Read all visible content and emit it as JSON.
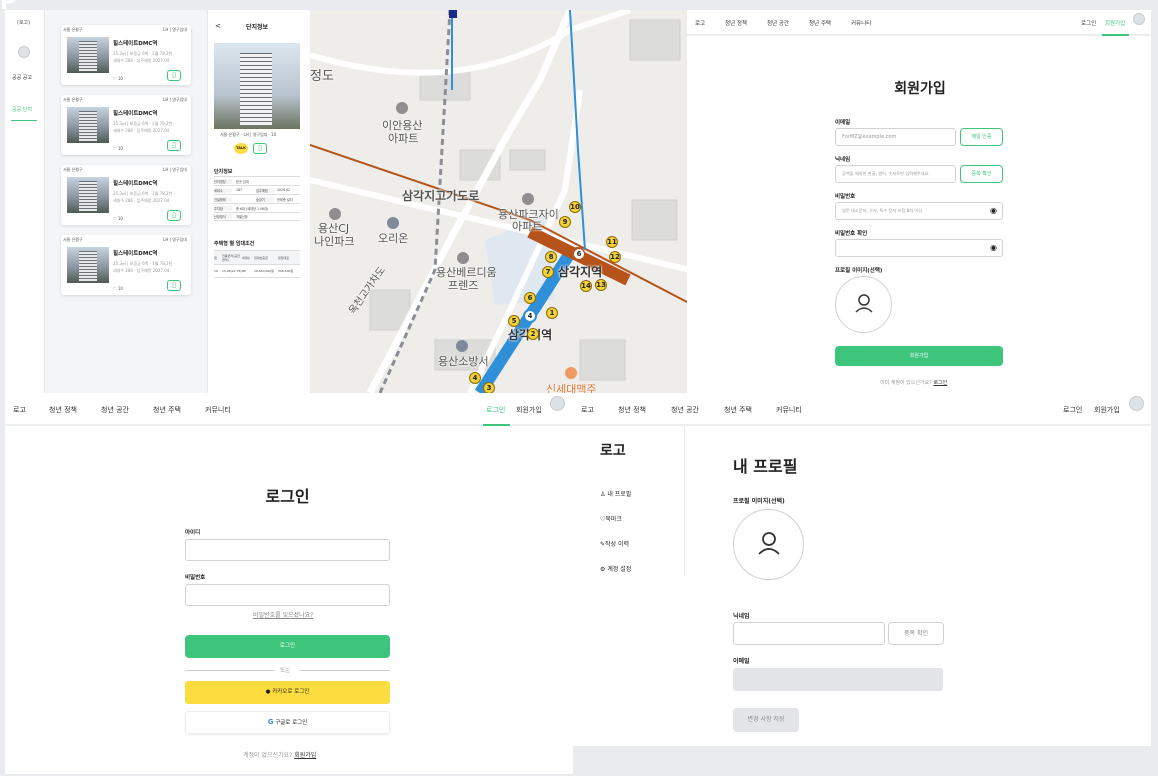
{
  "top_left_partial": "P",
  "housing": {
    "logo": "(로고)",
    "menu": [
      "공공 공고",
      "공공 단지"
    ],
    "cards": [
      {
        "region": "서울 은평구",
        "org": "LH | 영구임대",
        "name": "힐스테이트DMC역",
        "line1": "25.3㎡ | 보증금 6백 · 1월 78,2천 ·",
        "line2": "세대수 286 · 입주예정 2027.04",
        "likes": "10"
      },
      {
        "region": "서울 은평구",
        "org": "LH | 영구임대",
        "name": "힐스테이트DMC역",
        "line1": "25.3㎡ | 보증금 6백 · 1월 78,2천 ·",
        "line2": "세대수 286 · 입주예정 2027.04",
        "likes": "10"
      },
      {
        "region": "서울 은평구",
        "org": "LH | 영구임대",
        "name": "힐스테이트DMC역",
        "line1": "25.3㎡ | 보증금 6백 · 1월 78,2천 ·",
        "line2": "세대수 286 · 입주예정 2027.04",
        "likes": "10"
      },
      {
        "region": "서울 은평구",
        "org": "LH | 영구임대",
        "name": "힐스테이트DMC역",
        "line1": "25.3㎡ | 보증금 6백 · 1월 78,2천 ·",
        "line2": "세대수 286 · 입주예정 2027.04",
        "likes": "10"
      }
    ],
    "detail": {
      "back": "<",
      "title": "단지정보",
      "meta": "서울 은평구 · LH | 영구임대 · 10",
      "talk": "TALK",
      "section1": "단지정보",
      "table": [
        [
          "단지명칭",
          "한곳 임대"
        ],
        [
          "세대수",
          "187",
          "입주예정",
          "2026.02"
        ],
        [
          "건설형태",
          "",
          "승강기",
          "전체층 설치"
        ],
        [
          "주차장",
          "총 6대 (세대당 1.06대)"
        ],
        [
          "난방방식",
          "개별난방"
        ]
      ],
      "section2": "주택형 별 임대조건",
      "cond_head": [
        "형",
        "전용면적(공급면적)",
        "세대수",
        "임대보증금",
        "월임대료"
      ],
      "cond_row": [
        "10",
        "15.48(21.78)",
        "86",
        "18,650,000원",
        "306,500원"
      ]
    }
  },
  "map": {
    "labels": [
      "정도",
      "이안용산",
      "아파트",
      "삼각지고가도로",
      "용산파크자이",
      "아파트",
      "용산CJ",
      "나인파크",
      "오리온",
      "삼각지역",
      "용산베르디움",
      "프렌즈",
      "삼각지역",
      "옥천고가차도",
      "용산소방서",
      "신세대맥주"
    ],
    "markers": [
      "10",
      "9",
      "11",
      "6",
      "12",
      "8",
      "7",
      "14",
      "13",
      "5",
      "1",
      "4",
      "2",
      "4",
      "3",
      "6"
    ]
  },
  "signup": {
    "nav": [
      "로고",
      "청년 정책",
      "청년 공간",
      "청년 주택",
      "커뮤니티"
    ],
    "nav_right": [
      "로그인",
      "회원가입"
    ],
    "title": "회원가입",
    "email_label": "이메일",
    "email_ph": "ForMZ@example.com",
    "email_btn": "메일 인증",
    "nick_label": "닉네임",
    "nick_ph": "공백을 제외한 한글, 영어, 숫자로만 입력해주세요.",
    "nick_btn": "중복 확인",
    "pw_label": "비밀번호",
    "pw_ph": "영문 대소문자, 숫자, 특수 문자 포함 8자 이상",
    "pw2_label": "비밀번호 확인",
    "profile_label": "프로필 이미지(선택)",
    "submit": "회원가입",
    "footer": "이미 계정이 있으신가요?",
    "footer_link": "로그인"
  },
  "login": {
    "nav": [
      "로고",
      "청년 정책",
      "청년 공간",
      "청년 주택",
      "커뮤니티"
    ],
    "nav_right": [
      "로그인",
      "회원가입"
    ],
    "title": "로그인",
    "id_label": "아이디",
    "pw_label": "비밀번호",
    "forgot": "비밀번호를 잊으셨나요?",
    "submit": "로그인",
    "or": "또는",
    "kakao": "카카오로 로그인",
    "google": "구글로 로그인",
    "footer": "계정이 없으신가요?",
    "footer_link": "회원가입"
  },
  "profile": {
    "nav": [
      "로고",
      "청년 정책",
      "청년 공간",
      "청년 주택",
      "커뮤니티"
    ],
    "nav_right": [
      "로그인",
      "회원가입"
    ],
    "side_logo": "로고",
    "side_items": [
      "내 프로필",
      "북마크",
      "작성 이력",
      "계정 설정"
    ],
    "title": "내 프로필",
    "img_label": "프로필 이미지(선택)",
    "nick_label": "닉네임",
    "nick_btn": "중복 확인",
    "email_label": "이메일",
    "save": "변경 사항 저장"
  },
  "colors": {
    "green": "#3ec57c",
    "kakao": "#fddc3f",
    "map_brown": "#b5531a",
    "map_blue": "#2f8fd8"
  }
}
